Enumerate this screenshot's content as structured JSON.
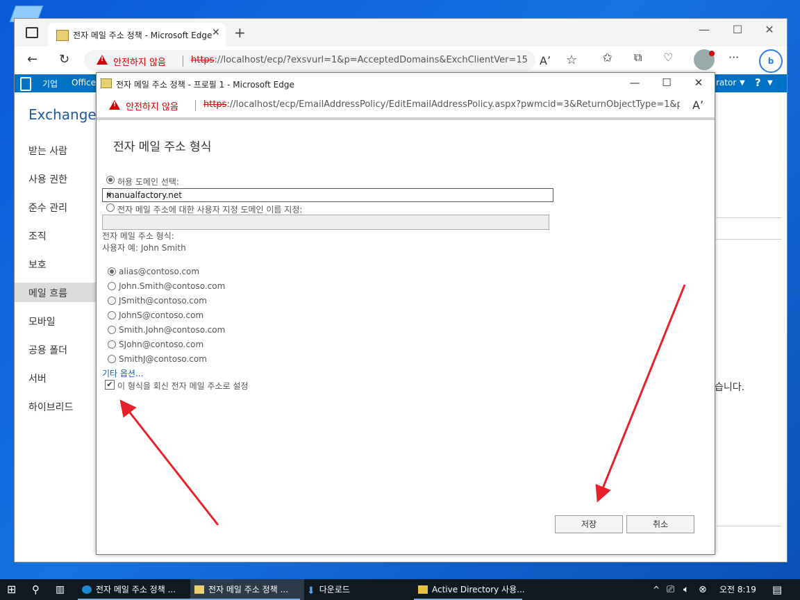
{
  "main_window": {
    "tab_title": "전자 메일 주소 정책 - Microsoft Edge",
    "new_tab": "+",
    "controls": {
      "minimize": "—",
      "maximize": "☐",
      "close": "✕"
    },
    "address": {
      "warning": "안전하지 않음",
      "scheme": "https",
      "url_rest": "://localhost/ecp/?exsvurl=1&p=AcceptedDomains&ExchClientVer=15"
    },
    "toolbar_icons": [
      "read-aloud-icon",
      "favorite-star-icon",
      "favorites-icon",
      "collections-icon",
      "performance-icon",
      "profile-icon",
      "more-icon",
      "bing-icon"
    ],
    "more": "···",
    "bing": "b"
  },
  "office_bar": {
    "items": [
      "기업",
      "Office"
    ],
    "right_text": "rator",
    "help": "?"
  },
  "eac": {
    "title": "Exchange",
    "nav": [
      "받는 사람",
      "사용 권한",
      "준수 관리",
      "조직",
      "보호",
      "메일 흐름",
      "모바일",
      "공용 폴더",
      "서버",
      "하이브리드"
    ],
    "active_index": 5,
    "partial_text": "습니다."
  },
  "dialog": {
    "title": "전자 메일 주소 정책 - 프로필 1 - Microsoft Edge",
    "controls": {
      "minimize": "—",
      "maximize": "☐",
      "close": "✕"
    },
    "address": {
      "warning": "안전하지 않음",
      "scheme": "https",
      "url_rest": "://localhost/ecp/EmailAddressPolicy/EditEmailAddressPolicy.aspx?pwmcid=3&ReturnObjectType=1&prio..."
    },
    "content": {
      "heading": "전자 메일 주소 형식",
      "radio_accepted": "허용 도메인 선택:",
      "selected_domain": "manualfactory.net",
      "radio_custom": "전자 메일 주소에 대한 사용자 지정 도메인 이름 지정:",
      "custom_domain_value": "",
      "format_label": "전자 메일 주소 형식:",
      "example_label": "사용자 예: John Smith",
      "formats": [
        "alias@contoso.com",
        "John.Smith@contoso.com",
        "JSmith@contoso.com",
        "JohnS@contoso.com",
        "Smith.John@contoso.com",
        "SJohn@contoso.com",
        "SmithJ@contoso.com"
      ],
      "selected_format_index": 0,
      "more_options": "기타 옵션...",
      "reply_checkbox": "이 형식을 회신 전자 메일 주소로 설정",
      "reply_checked": true
    },
    "buttons": {
      "save": "저장",
      "cancel": "취소"
    }
  },
  "taskbar": {
    "items": [
      "전자 메일 주소 정책 ...",
      "전자 메일 주소 정책 ...",
      "다운로드",
      "Active Directory 사용..."
    ],
    "active_index": 1,
    "tray_caret": "^",
    "time": "오전 8:19"
  },
  "colors": {
    "accent": "#0072c6",
    "eac_title": "#1c5aa6",
    "warning": "#cc0000",
    "arrow": "#e8202a"
  }
}
